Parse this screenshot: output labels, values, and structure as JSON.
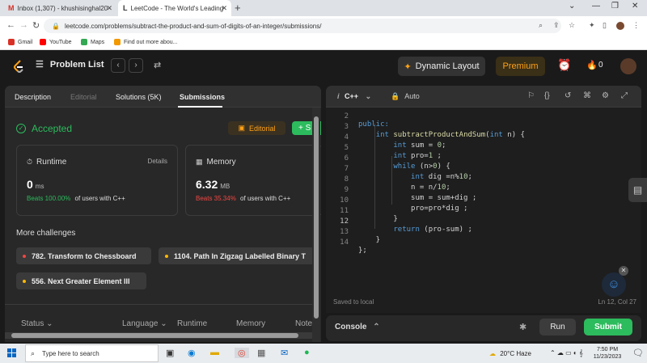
{
  "browser": {
    "tabs": [
      {
        "icon": "M",
        "label": "Inbox (1,307) - khushisinghal20",
        "active": false
      },
      {
        "icon": "L",
        "label": "LeetCode - The World's Leading",
        "active": true
      }
    ],
    "url": "leetcode.com/problems/subtract-the-product-and-sum-of-digits-of-an-integer/submissions/",
    "bookmarks": [
      "Gmail",
      "YouTube",
      "Maps",
      "Find out more abou..."
    ]
  },
  "header": {
    "problem_list": "Problem List",
    "dynamic_layout": "Dynamic Layout",
    "premium": "Premium",
    "streak_count": "0"
  },
  "left": {
    "tabs": [
      "Description",
      "Editorial",
      "Solutions (5K)",
      "Submissions"
    ],
    "status": "Accepted",
    "editorial_button": "Editorial",
    "solution_button": "+ S",
    "runtime": {
      "title": "Runtime",
      "details": "Details",
      "value": "0",
      "unit": "ms",
      "beats_pct": "Beats 100.00%",
      "beats_rest": "of users with C++"
    },
    "memory": {
      "title": "Memory",
      "value": "6.32",
      "unit": "MB",
      "beats_pct": "Beats 35.34%",
      "beats_rest": "of users with C++"
    },
    "more_challenges": "More challenges",
    "challenges": [
      {
        "label": "782. Transform to Chessboard",
        "color": "#ef4743"
      },
      {
        "label": "1104. Path In Zigzag Labelled Binary T",
        "color": "#ffb800"
      },
      {
        "label": "556. Next Greater Element III",
        "color": "#ffb800"
      }
    ],
    "columns": [
      "Status",
      "Language",
      "Runtime",
      "Memory",
      "Note"
    ]
  },
  "editor": {
    "language": "C++",
    "mode": "Auto",
    "lines": [
      {
        "n": "2",
        "code": "public:"
      },
      {
        "n": "3",
        "code": "    int subtractProductAndSum(int n) {"
      },
      {
        "n": "4",
        "code": "        int sum = 0;"
      },
      {
        "n": "5",
        "code": "        int pro=1 ;"
      },
      {
        "n": "6",
        "code": "        while (n>0) {"
      },
      {
        "n": "7",
        "code": "            int dig =n%10;"
      },
      {
        "n": "8",
        "code": "            n = n/10;"
      },
      {
        "n": "9",
        "code": "            sum = sum+dig ;"
      },
      {
        "n": "10",
        "code": "            pro=pro*dig ;"
      },
      {
        "n": "11",
        "code": "        }"
      },
      {
        "n": "12",
        "code": "        return (pro-sum) ;"
      },
      {
        "n": "13",
        "code": "    }"
      },
      {
        "n": "14",
        "code": "};"
      }
    ],
    "saved": "Saved to local",
    "cursor": "Ln 12, Col 27"
  },
  "console": {
    "label": "Console",
    "run": "Run",
    "submit": "Submit"
  },
  "taskbar": {
    "search_placeholder": "Type here to search",
    "weather": "20°C  Haze",
    "time": "7:50 PM",
    "date": "11/23/2023"
  }
}
